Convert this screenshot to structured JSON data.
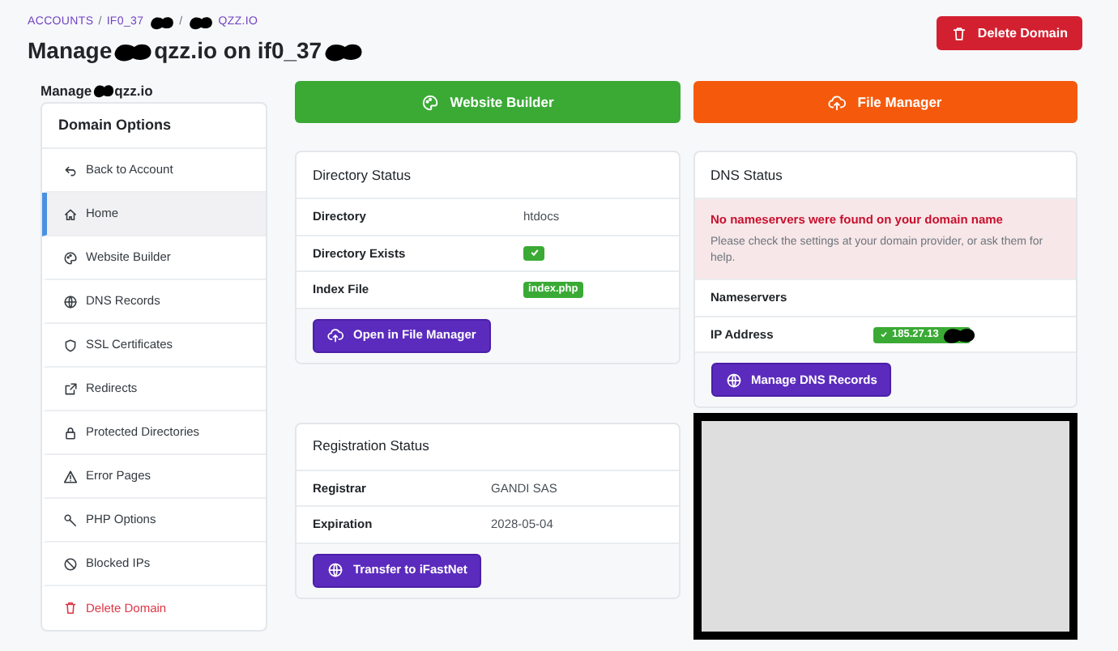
{
  "breadcrumb": [
    {
      "kind": "link",
      "text": "ACCOUNTS"
    },
    {
      "kind": "sep",
      "text": "/"
    },
    {
      "kind": "link",
      "text": "IF0_37"
    },
    {
      "kind": "redaction"
    },
    {
      "kind": "sep",
      "text": "/"
    },
    {
      "kind": "redaction"
    },
    {
      "kind": "link",
      "text": "QZZ.IO"
    }
  ],
  "title": [
    {
      "kind": "text",
      "text": "Manage"
    },
    {
      "kind": "redaction"
    },
    {
      "kind": "text",
      "text": "qzz.io on if0_37"
    },
    {
      "kind": "redaction"
    }
  ],
  "delete_button": "Delete Domain",
  "sidebar": {
    "heading": [
      {
        "kind": "text",
        "text": "Manage"
      },
      {
        "kind": "redaction"
      },
      {
        "kind": "text",
        "text": "qzz.io"
      }
    ],
    "title": "Domain Options",
    "items": [
      {
        "label": "Back to Account",
        "selected": false,
        "kind": "normal"
      },
      {
        "label": "Home",
        "selected": true,
        "kind": "normal"
      },
      {
        "label": "Website Builder",
        "selected": false,
        "kind": "normal"
      },
      {
        "label": "DNS Records",
        "selected": false,
        "kind": "normal"
      },
      {
        "label": "SSL Certificates",
        "selected": false,
        "kind": "normal"
      },
      {
        "label": "Redirects",
        "selected": false,
        "kind": "normal"
      },
      {
        "label": "Protected Directories",
        "selected": false,
        "kind": "normal"
      },
      {
        "label": "Error Pages",
        "selected": false,
        "kind": "normal"
      },
      {
        "label": "PHP Options",
        "selected": false,
        "kind": "normal"
      },
      {
        "label": "Blocked IPs",
        "selected": false,
        "kind": "normal"
      },
      {
        "label": "Delete Domain",
        "selected": false,
        "kind": "danger"
      }
    ]
  },
  "big_buttons": [
    {
      "label": "Website Builder",
      "color": "#3aaa35"
    },
    {
      "label": "File Manager",
      "color": "#f55a0c"
    }
  ],
  "directory_status": {
    "title": "Directory Status",
    "rows": [
      {
        "label": "Directory",
        "kind": "text",
        "value": "htdocs"
      },
      {
        "label": "Directory Exists",
        "kind": "check"
      },
      {
        "label": "Index File",
        "kind": "badge",
        "value": "index.php"
      }
    ],
    "button": "Open in File Manager"
  },
  "dns_status": {
    "title": "DNS Status",
    "alert_title": "No nameservers were found on your domain name",
    "alert_text": "Please check the settings at your domain provider, or ask them for help.",
    "rows": [
      {
        "label": "Nameservers",
        "kind": "empty"
      },
      {
        "label": "IP Address",
        "kind": "ip",
        "value": "185.27.13"
      }
    ],
    "button": "Manage DNS Records"
  },
  "registration_status": {
    "title": "Registration Status",
    "rows": [
      {
        "label": "Registrar",
        "kind": "text",
        "value": "GANDI SAS"
      },
      {
        "label": "Expiration",
        "kind": "text",
        "value": "2028-05-04"
      }
    ],
    "button": "Transfer to iFastNet"
  }
}
